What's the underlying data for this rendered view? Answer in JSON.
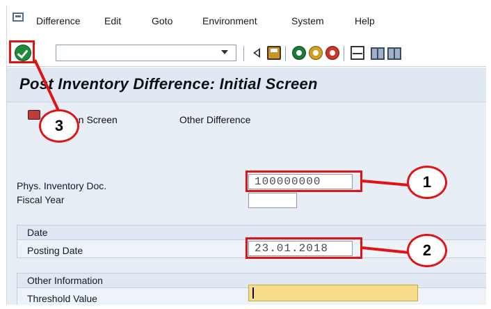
{
  "menubar": {
    "items": [
      "Difference",
      "Edit",
      "Goto",
      "Environment",
      "System",
      "Help"
    ]
  },
  "toolbar": {
    "command_value": ""
  },
  "title": "Post Inventory Difference: Initial Screen",
  "app_toolbar": {
    "selection_screen": "Selection Screen",
    "selection_screen_visible": "tion Screen",
    "other_difference": "Other Difference"
  },
  "form": {
    "phys_inventory_doc_label": "Phys. Inventory Doc.",
    "phys_inventory_doc_value": "100000000",
    "fiscal_year_label": "Fiscal Year",
    "fiscal_year_value": "",
    "date_group_title": "Date",
    "posting_date_label": "Posting Date",
    "posting_date_value": "23.01.2018",
    "other_info_group_title": "Other Information",
    "threshold_value_label": "Threshold Value",
    "threshold_value_value": ""
  },
  "annotations": {
    "callout_1": "1",
    "callout_2": "2",
    "callout_3": "3",
    "highlight_color": "#e01414"
  }
}
